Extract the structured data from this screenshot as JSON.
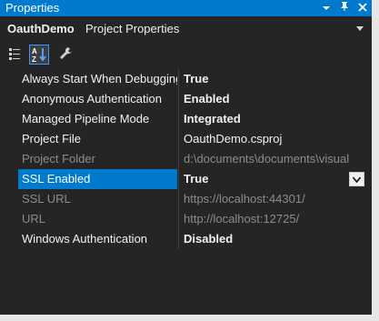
{
  "window": {
    "title": "Properties",
    "pin_icon": "pin-icon",
    "close_icon": "close-icon",
    "dropdown_icon": "chevron-down-icon"
  },
  "object": {
    "name": "OauthDemo",
    "type": "Project Properties"
  },
  "toolbar": {
    "buttons": [
      {
        "icon": "categorized-icon",
        "active": false
      },
      {
        "icon": "alphabetical-icon",
        "active": true
      },
      {
        "icon": "property-pages-wrench-icon",
        "active": false
      }
    ]
  },
  "properties": [
    {
      "name": "Always Start When Debugging",
      "value": "True",
      "bold": true,
      "disabled": false
    },
    {
      "name": "Anonymous Authentication",
      "value": "Enabled",
      "bold": true,
      "disabled": false
    },
    {
      "name": "Managed Pipeline Mode",
      "value": "Integrated",
      "bold": true,
      "disabled": false
    },
    {
      "name": "Project File",
      "value": "OauthDemo.csproj",
      "bold": false,
      "disabled": false
    },
    {
      "name": "Project Folder",
      "value": "d:\\documents\\documents\\visual",
      "bold": false,
      "disabled": true
    },
    {
      "name": "SSL Enabled",
      "value": "True",
      "bold": true,
      "disabled": false,
      "selected": true
    },
    {
      "name": "SSL URL",
      "value": "https://localhost:44301/",
      "bold": false,
      "disabled": true
    },
    {
      "name": "URL",
      "value": "http://localhost:12725/",
      "bold": false,
      "disabled": true
    },
    {
      "name": "Windows Authentication",
      "value": "Disabled",
      "bold": true,
      "disabled": false
    }
  ],
  "colors": {
    "accent": "#007acc",
    "panel_bg": "#252526",
    "text": "#f1f1f1",
    "disabled_text": "#8c8c8c"
  }
}
